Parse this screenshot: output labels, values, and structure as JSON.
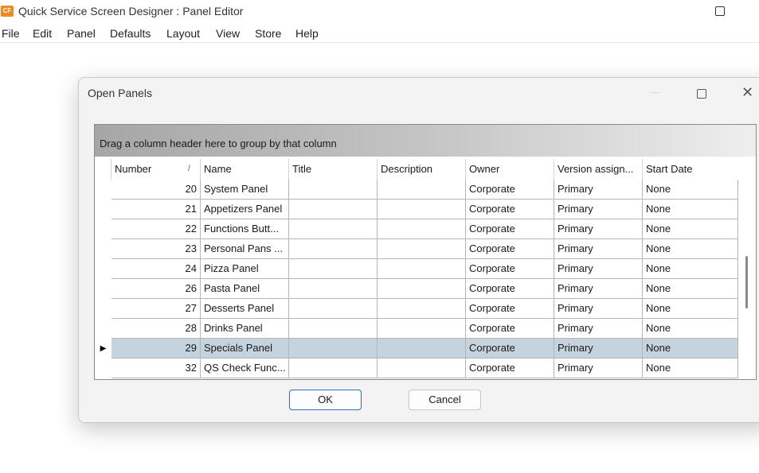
{
  "window": {
    "logo_text": "CF",
    "title": "Quick Service Screen Designer : Panel Editor"
  },
  "menu": [
    "File",
    "Edit",
    "Panel",
    "Defaults",
    "Layout",
    "View",
    "Store",
    "Help"
  ],
  "dialog": {
    "title": "Open Panels",
    "group_hint": "Drag a column header here to group by that column",
    "sort_indicator": "/",
    "columns": [
      "Number",
      "Name",
      "Title",
      "Description",
      "Owner",
      "Version assign...",
      "Start Date"
    ],
    "rows": [
      {
        "number": "20",
        "name": "System Panel",
        "title": "",
        "description": "",
        "owner": "Corporate",
        "version": "Primary",
        "start": "None"
      },
      {
        "number": "21",
        "name": "Appetizers Panel",
        "title": "",
        "description": "",
        "owner": "Corporate",
        "version": "Primary",
        "start": "None"
      },
      {
        "number": "22",
        "name": "Functions Butt...",
        "title": "",
        "description": "",
        "owner": "Corporate",
        "version": "Primary",
        "start": "None"
      },
      {
        "number": "23",
        "name": "Personal Pans ...",
        "title": "",
        "description": "",
        "owner": "Corporate",
        "version": "Primary",
        "start": "None"
      },
      {
        "number": "24",
        "name": "Pizza Panel",
        "title": "",
        "description": "",
        "owner": "Corporate",
        "version": "Primary",
        "start": "None"
      },
      {
        "number": "26",
        "name": "Pasta Panel",
        "title": "",
        "description": "",
        "owner": "Corporate",
        "version": "Primary",
        "start": "None"
      },
      {
        "number": "27",
        "name": "Desserts Panel",
        "title": "",
        "description": "",
        "owner": "Corporate",
        "version": "Primary",
        "start": "None"
      },
      {
        "number": "28",
        "name": "Drinks Panel",
        "title": "",
        "description": "",
        "owner": "Corporate",
        "version": "Primary",
        "start": "None"
      },
      {
        "number": "29",
        "name": "Specials Panel",
        "title": "",
        "description": "",
        "owner": "Corporate",
        "version": "Primary",
        "start": "None"
      },
      {
        "number": "32",
        "name": "QS Check Func...",
        "title": "",
        "description": "",
        "owner": "Corporate",
        "version": "Primary",
        "start": "None"
      }
    ],
    "selected_row": 8,
    "ok_label": "OK",
    "cancel_label": "Cancel"
  },
  "colors": {
    "selected_row": "#c5d3de",
    "ok_border": "#2f6fc0",
    "logo": "#f08a1c"
  }
}
